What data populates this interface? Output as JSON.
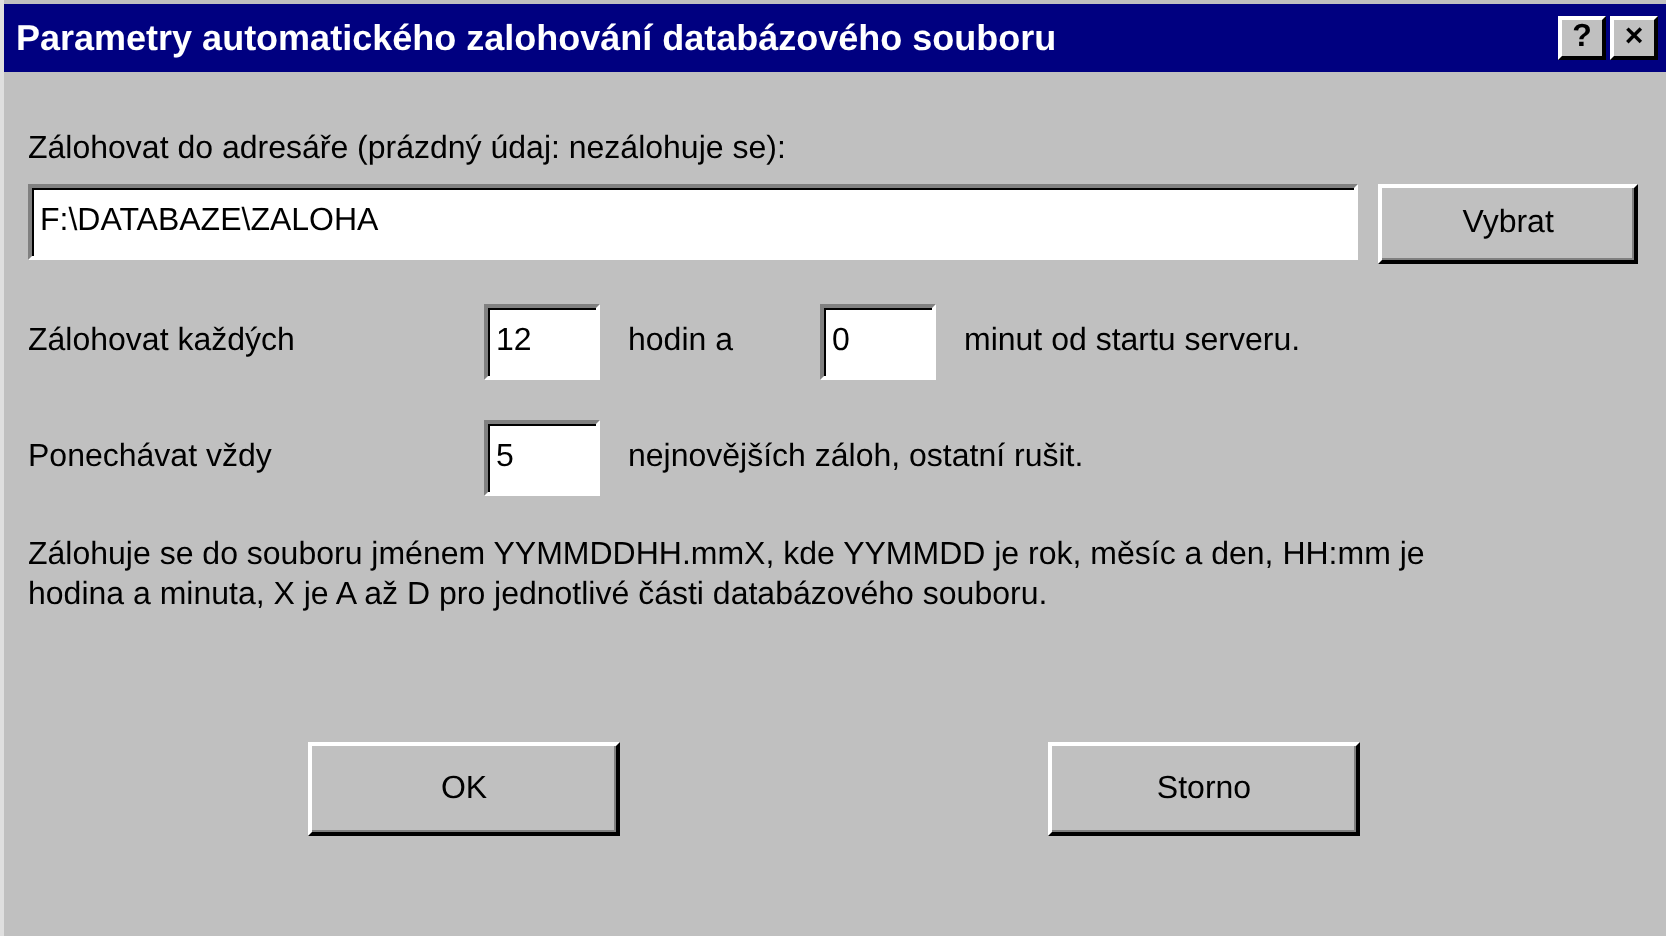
{
  "window": {
    "title": "Parametry automatického zalohování databázového souboru",
    "title_buttons": [
      "?",
      "×"
    ]
  },
  "directory": {
    "label": "Zálohovat do adresáře (prázdný údaj: nezálohuje se):",
    "value": "F:\\DATABAZE\\ZALOHA",
    "button": "Vybrat"
  },
  "interval": {
    "label": "Zálohovat každých",
    "hours": "12",
    "hours_label": "hodin a",
    "minutes": "0",
    "minutes_label": "minut od startu serveru."
  },
  "keep": {
    "label": "Ponechávat vždy",
    "count": "5",
    "count_label": "nejnovějších záloh, ostatní rušit."
  },
  "note": "Zálohuje se do souboru jménem YYMMDDHH.mmX, kde YYMMDD je rok, měsíc a den, HH:mm je hodina a minuta, X je A až D pro jednotlivé části databázového souboru.",
  "buttons": [
    "OK",
    "Storno"
  ]
}
